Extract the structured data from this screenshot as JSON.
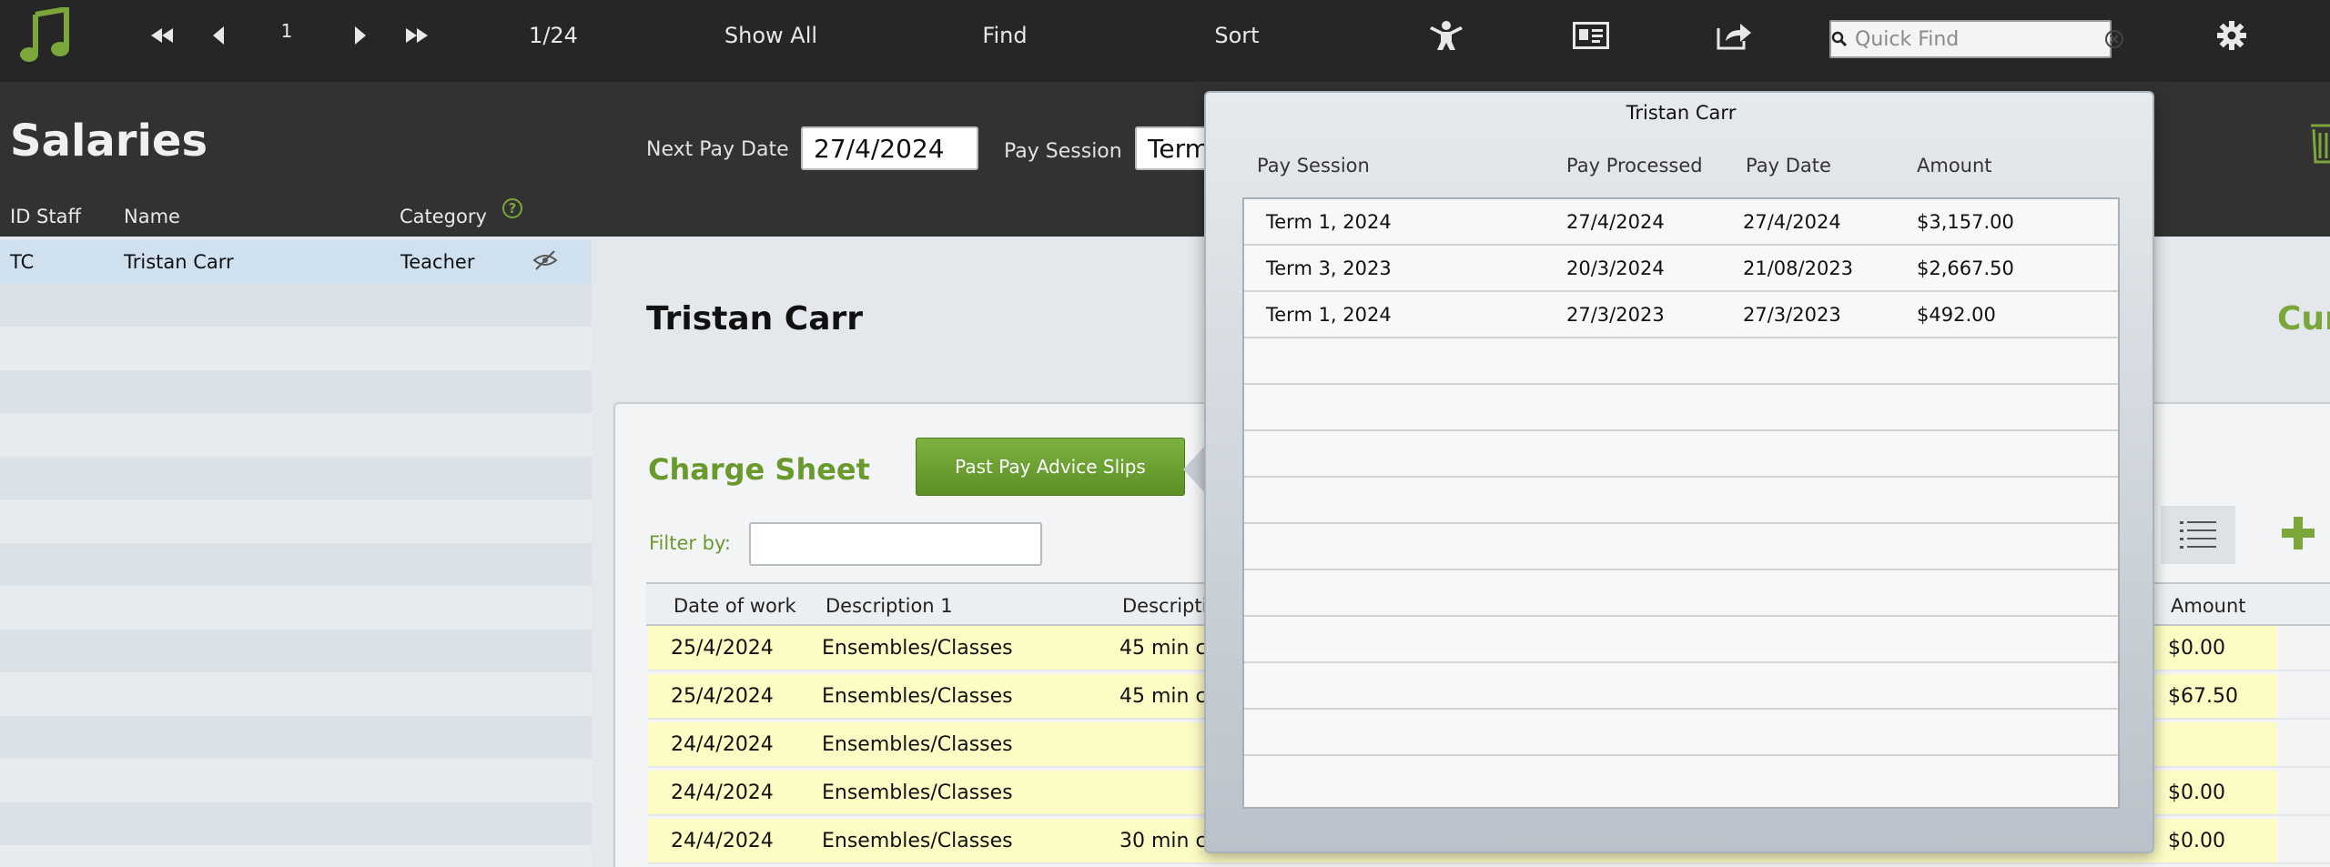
{
  "toolbar": {
    "record_number": "1",
    "record_count": "1/24",
    "show_all": "Show All",
    "find": "Find",
    "sort": "Sort",
    "quick_find_placeholder": "Quick Find"
  },
  "header": {
    "title": "Salaries",
    "next_pay_date_label": "Next Pay Date",
    "next_pay_date_value": "27/4/2024",
    "pay_session_label": "Pay Session",
    "pay_session_value": "Term"
  },
  "left_list": {
    "columns": [
      "ID Staff",
      "Name",
      "Category"
    ],
    "rows": [
      {
        "id": "TC",
        "name": "Tristan Carr",
        "category": "Teacher"
      }
    ]
  },
  "main": {
    "staff_name": "Tristan Carr",
    "current_label": "Cur",
    "charge_sheet_title": "Charge Sheet",
    "past_slips_button": "Past Pay Advice Slips",
    "filter_label": "Filter by:",
    "table": {
      "columns": {
        "date": "Date of work",
        "desc1": "Description 1",
        "desc2": "Descripti",
        "amount": "Amount"
      },
      "rows": [
        {
          "date": "25/4/2024",
          "desc1": "Ensembles/Classes",
          "desc2": "45 min cl",
          "amount": "$0.00"
        },
        {
          "date": "25/4/2024",
          "desc1": "Ensembles/Classes",
          "desc2": "45 min cl",
          "amount": "$67.50"
        },
        {
          "date": "24/4/2024",
          "desc1": "Ensembles/Classes",
          "desc2": "",
          "amount": ""
        },
        {
          "date": "24/4/2024",
          "desc1": "Ensembles/Classes",
          "desc2": "",
          "amount": "$0.00"
        },
        {
          "date": "24/4/2024",
          "desc1": "Ensembles/Classes",
          "desc2": "30 min cl",
          "amount": "$0.00"
        }
      ]
    }
  },
  "popover": {
    "title": "Tristan Carr",
    "columns": {
      "session": "Pay Session",
      "processed": "Pay Processed",
      "date": "Pay Date",
      "amount": "Amount"
    },
    "rows": [
      {
        "session": "Term 1, 2024",
        "processed": "27/4/2024",
        "date": "27/4/2024",
        "amount": "$3,157.00"
      },
      {
        "session": "Term 3, 2023",
        "processed": "20/3/2024",
        "date": "21/08/2023",
        "amount": "$2,667.50"
      },
      {
        "session": "Term 1, 2024",
        "processed": "27/3/2023",
        "date": "27/3/2023",
        "amount": "$492.00"
      }
    ]
  },
  "colors": {
    "accent_green": "#7aa63a",
    "toolbar_bg": "#262626",
    "header_bg": "#323232",
    "row_highlight": "#fdfcc4"
  }
}
